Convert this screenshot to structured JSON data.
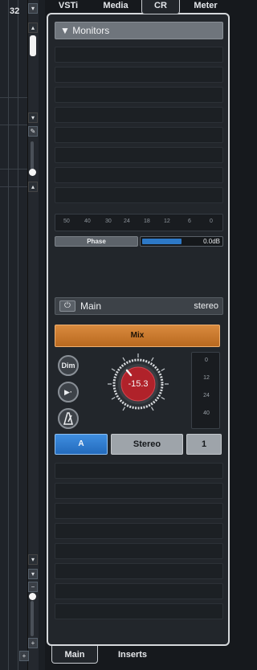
{
  "left": {
    "track_number": "32",
    "down_arrow": "▾",
    "up_arrow": "▴",
    "pencil": "✎",
    "plus": "+",
    "minus": "−"
  },
  "tabs": [
    {
      "label": "VSTi"
    },
    {
      "label": "Media"
    },
    {
      "label": "CR"
    },
    {
      "label": "Meter"
    }
  ],
  "monitors": {
    "title": "Monitors",
    "collapse_glyph": "▼"
  },
  "meter": {
    "scale": [
      "50",
      "40",
      "30",
      "24",
      "18",
      "12",
      "6",
      "0"
    ],
    "phase_label": "Phase",
    "level_value": "0.0dB",
    "level_fraction": 0.5
  },
  "main": {
    "power_glyph": "⏻",
    "label": "Main",
    "format": "stereo",
    "mix_label": "Mix",
    "dim_label": "Dim",
    "talk_glyph": "▶·",
    "knob_value": "-15.3",
    "mini_scale": [
      "0",
      "12",
      "24",
      "40"
    ],
    "a_label": "A",
    "stereo_label": "Stereo",
    "one_label": "1"
  },
  "bottom_tabs": [
    {
      "label": "Main"
    },
    {
      "label": "Inserts"
    }
  ],
  "colors": {
    "accent_orange": "#c97a2d",
    "accent_blue": "#2d78c6",
    "knob_red": "#b0222a"
  }
}
